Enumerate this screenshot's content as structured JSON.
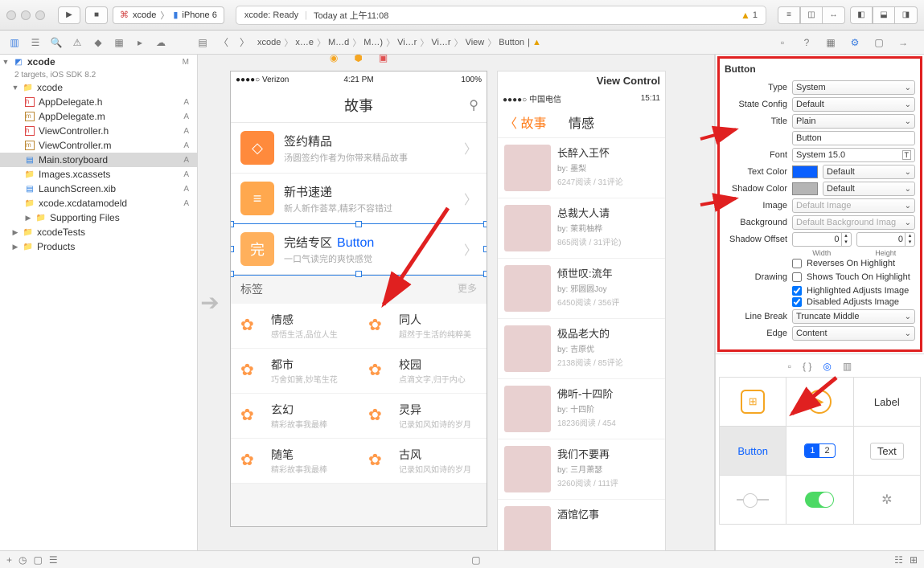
{
  "toolbar": {
    "scheme_app": "xcode",
    "scheme_device": "iPhone 6",
    "status_left": "xcode: Ready",
    "status_right": "Today at 上午11:08",
    "warn_count": "1"
  },
  "breadcrumb": [
    "xcode",
    "x…e",
    "M…d",
    "M…)",
    "Vi…r",
    "Vi…r",
    "View",
    "Button"
  ],
  "nav": {
    "root": {
      "name": "xcode",
      "sub": "2 targets, iOS SDK 8.2",
      "status": "M"
    },
    "group": "xcode",
    "files": [
      {
        "name": "AppDelegate.h",
        "kind": "h",
        "status": "A"
      },
      {
        "name": "AppDelegate.m",
        "kind": "m",
        "status": "A"
      },
      {
        "name": "ViewController.h",
        "kind": "h",
        "status": "A"
      },
      {
        "name": "ViewController.m",
        "kind": "m",
        "status": "A"
      },
      {
        "name": "Main.storyboard",
        "kind": "sb",
        "status": "A",
        "sel": true
      },
      {
        "name": "Images.xcassets",
        "kind": "folder",
        "status": "A"
      },
      {
        "name": "LaunchScreen.xib",
        "kind": "sb",
        "status": "A"
      },
      {
        "name": "xcode.xcdatamodeld",
        "kind": "folder",
        "status": "A"
      }
    ],
    "folders": [
      "Supporting Files",
      "xcodeTests",
      "Products"
    ]
  },
  "phone1": {
    "carrier": "●●●●○ Verizon",
    "time": "4:21 PM",
    "battery": "100%",
    "title": "故事",
    "sections": [
      {
        "title": "签约精品",
        "sub": "汤圆签约作者为你带来精品故事",
        "icon": "◇"
      },
      {
        "title": "新书速递",
        "sub": "新人新作荟萃,精彩不容错过",
        "icon": "≡"
      },
      {
        "title": "完结专区",
        "sub": "一口气读完的爽快感觉",
        "icon": "完",
        "button": "Button"
      }
    ],
    "tags_hdr": "标签",
    "tags_more": "更多",
    "tags": [
      {
        "t": "情感",
        "s": "感悟生活,品位人生"
      },
      {
        "t": "同人",
        "s": "超然于生活的纯粹美"
      },
      {
        "t": "都市",
        "s": "巧舍如簧,妙笔生花"
      },
      {
        "t": "校园",
        "s": "点滴文字,归于内心"
      },
      {
        "t": "玄幻",
        "s": "精彩故事我最棒"
      },
      {
        "t": "灵异",
        "s": "记录如风如诗的岁月"
      },
      {
        "t": "随笔",
        "s": "精彩故事我最棒"
      },
      {
        "t": "古风",
        "s": "记录如风如诗的岁月"
      }
    ]
  },
  "phone2": {
    "carrier": "●●●●○ 中国电信",
    "time": "15:11",
    "back": "故事",
    "title": "情感",
    "heading": "View Control",
    "items": [
      {
        "t": "长醉入王怀",
        "a": "by: 墨梨",
        "c": "6247阅读 / 31评论"
      },
      {
        "t": "总裁大人请",
        "a": "by: 茉莉柚桦",
        "c": "865阅读 / 31评论)"
      },
      {
        "t": "倾世叹:流年",
        "a": "by: 邪圆圆Joy",
        "c": "6450阅读 / 356评"
      },
      {
        "t": "极品老大的",
        "a": "by: 吉原优",
        "c": "2138阅读 / 85评论"
      },
      {
        "t": "佛听-十四阶",
        "a": "by: 十四阶",
        "c": "18236阅读 / 454"
      },
      {
        "t": "我们不要再",
        "a": "by: 三月萧瑟",
        "c": "3260阅读 / 111评"
      },
      {
        "t": "酒馆忆事",
        "a": "",
        "c": ""
      }
    ]
  },
  "inspector": {
    "header": "Button",
    "type": "System",
    "state_config": "Default",
    "title_mode": "Plain",
    "title_value": "Button",
    "font": "System 15.0",
    "text_color": "Default",
    "shadow_color": "Default",
    "image": "Default Image",
    "background": "Default Background Imag",
    "offset_w": "0",
    "offset_h": "0",
    "offset_w_lbl": "Width",
    "offset_h_lbl": "Height",
    "reverses": "Reverses On Highlight",
    "shows_touch": "Shows Touch On Highlight",
    "hl_adj": "Highlighted Adjusts Image",
    "dis_adj": "Disabled Adjusts Image",
    "line_break": "Truncate Middle",
    "edge": "Content",
    "labels": {
      "type": "Type",
      "state": "State Config",
      "title": "Title",
      "font": "Font",
      "text_color": "Text Color",
      "shadow_color": "Shadow Color",
      "image": "Image",
      "background": "Background",
      "shadow_offset": "Shadow Offset",
      "drawing": "Drawing",
      "line_break": "Line Break",
      "edge": "Edge"
    }
  },
  "library": {
    "cells": [
      "",
      "",
      "Label",
      "Button",
      "",
      "Text",
      "",
      "",
      ""
    ]
  }
}
